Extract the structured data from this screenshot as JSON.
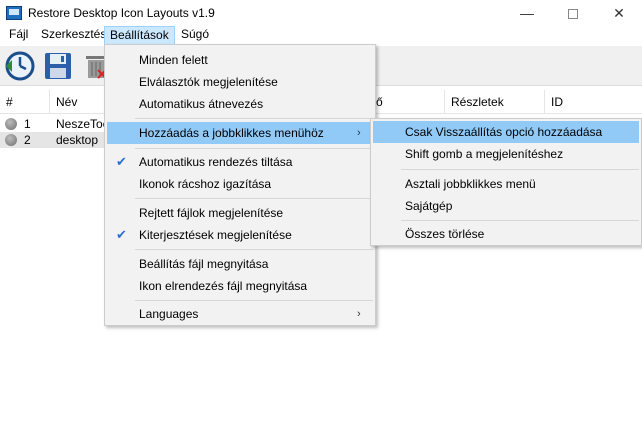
{
  "window": {
    "title": "Restore Desktop Icon Layouts v1.9",
    "min_glyph": "—",
    "close_glyph": "✕"
  },
  "menubar": {
    "items": [
      "Fájl",
      "Szerkesztés",
      "Beállítások",
      "Súgó"
    ]
  },
  "grid": {
    "headers": [
      "#",
      "Név",
      "ő",
      "Részletek",
      "ID"
    ],
    "rows": [
      {
        "num": "1",
        "name": "NeszeTool"
      },
      {
        "num": "2",
        "name": "desktop"
      }
    ]
  },
  "settings_menu": {
    "items": [
      "Minden felett",
      "Elválasztók megjelenítése",
      "Automatikus átnevezés",
      "Hozzáadás a jobbklikkes menühöz",
      "Automatikus rendezés tiltása",
      "Ikonok rácshoz igazítása",
      "Rejtett fájlok megjelenítése",
      "Kiterjesztések megjelenítése",
      "Beállítás fájl megnyitása",
      "Ikon elrendezés fájl megnyitása",
      "Languages"
    ],
    "check_glyph": "✔",
    "submenu_arrow": "›"
  },
  "context_submenu": {
    "items": [
      "Csak Visszaállítás opció hozzáadása",
      "Shift gomb a megjelenítéshez",
      "Asztali jobbklikkes menü",
      "Sajátgép",
      "Összes törlése"
    ]
  },
  "colors": {
    "highlight": "#91c9f7",
    "menubar_active": "#cce8ff",
    "check": "#2a6fd6"
  },
  "icons": [
    "restore-clock-icon",
    "save-disk-icon",
    "trash-icon"
  ]
}
